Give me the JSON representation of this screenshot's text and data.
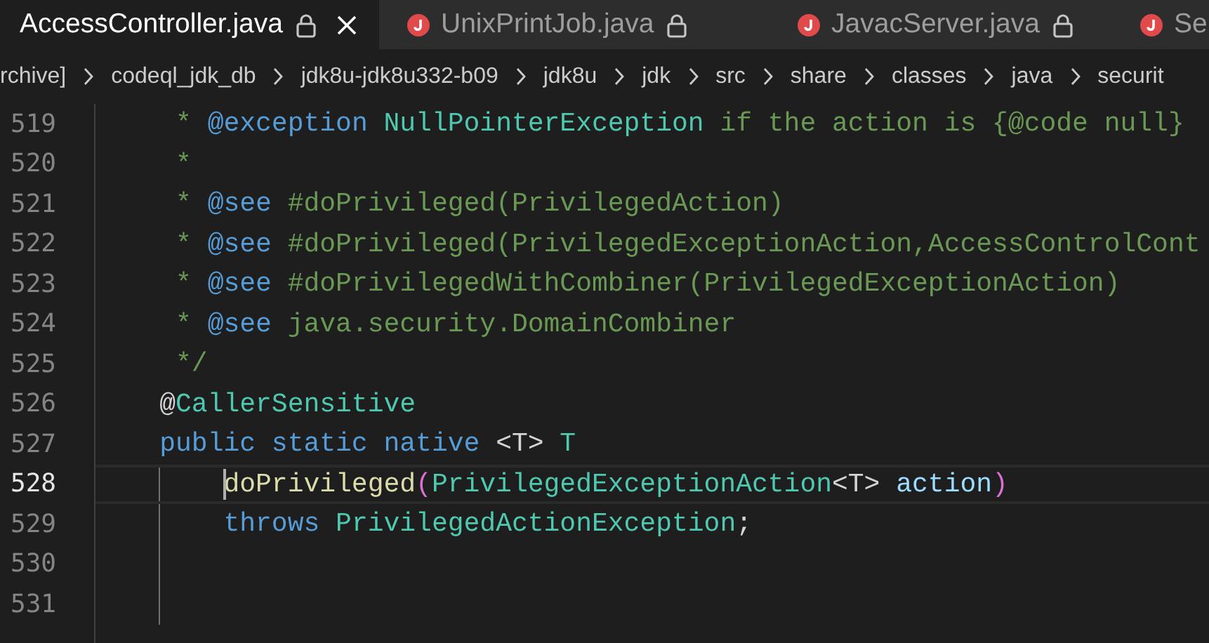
{
  "tabs": [
    {
      "label": "AccessController.java",
      "selected": true,
      "locked": true,
      "closable": true,
      "file_icon": false
    },
    {
      "label": "UnixPrintJob.java",
      "selected": false,
      "locked": true,
      "closable": false,
      "file_icon": true
    },
    {
      "label": "JavacServer.java",
      "selected": false,
      "locked": true,
      "closable": false,
      "file_icon": true
    },
    {
      "label": "Se",
      "selected": false,
      "locked": false,
      "closable": false,
      "file_icon": true
    }
  ],
  "breadcrumbs": [
    "rchive]",
    "codeql_jdk_db",
    "jdk8u-jdk8u332-b09",
    "jdk8u",
    "jdk",
    "src",
    "share",
    "classes",
    "java",
    "securit"
  ],
  "editor": {
    "lines": [
      {
        "number": "519",
        "current": false,
        "in_method": false,
        "tokens": [
          {
            "text": "     * ",
            "kind": "comment"
          },
          {
            "text": "@exception ",
            "kind": "tag"
          },
          {
            "text": "NullPointerException",
            "kind": "type"
          },
          {
            "text": " if the action is {@code null}",
            "kind": "comment"
          }
        ]
      },
      {
        "number": "520",
        "current": false,
        "in_method": false,
        "tokens": [
          {
            "text": "     *",
            "kind": "comment"
          }
        ]
      },
      {
        "number": "521",
        "current": false,
        "in_method": false,
        "tokens": [
          {
            "text": "     * ",
            "kind": "comment"
          },
          {
            "text": "@see",
            "kind": "tag"
          },
          {
            "text": " #doPrivileged(PrivilegedAction)",
            "kind": "comment"
          }
        ]
      },
      {
        "number": "522",
        "current": false,
        "in_method": false,
        "tokens": [
          {
            "text": "     * ",
            "kind": "comment"
          },
          {
            "text": "@see",
            "kind": "tag"
          },
          {
            "text": " #doPrivileged(PrivilegedExceptionAction,AccessControlCont",
            "kind": "comment"
          }
        ]
      },
      {
        "number": "523",
        "current": false,
        "in_method": false,
        "tokens": [
          {
            "text": "     * ",
            "kind": "comment"
          },
          {
            "text": "@see",
            "kind": "tag"
          },
          {
            "text": " #doPrivilegedWithCombiner(PrivilegedExceptionAction)",
            "kind": "comment"
          }
        ]
      },
      {
        "number": "524",
        "current": false,
        "in_method": false,
        "tokens": [
          {
            "text": "     * ",
            "kind": "comment"
          },
          {
            "text": "@see",
            "kind": "tag"
          },
          {
            "text": " java.security.DomainCombiner",
            "kind": "comment"
          }
        ]
      },
      {
        "number": "525",
        "current": false,
        "in_method": false,
        "tokens": [
          {
            "text": "     */",
            "kind": "comment"
          }
        ]
      },
      {
        "number": "526",
        "current": false,
        "in_method": false,
        "tokens": [
          {
            "text": "    @",
            "kind": "plain"
          },
          {
            "text": "CallerSensitive",
            "kind": "type"
          }
        ]
      },
      {
        "number": "527",
        "current": false,
        "in_method": false,
        "tokens": [
          {
            "text": "    public static native",
            "kind": "keyword"
          },
          {
            "text": " <T> ",
            "kind": "plain"
          },
          {
            "text": "T",
            "kind": "type"
          }
        ]
      },
      {
        "number": "528",
        "current": true,
        "in_method": true,
        "tokens": [
          {
            "text": "        doPrivileged",
            "kind": "function",
            "cursor": true
          },
          {
            "text": "(",
            "kind": "bracket"
          },
          {
            "text": "PrivilegedExceptionAction",
            "kind": "type"
          },
          {
            "text": "<T> ",
            "kind": "plain"
          },
          {
            "text": "action",
            "kind": "param"
          },
          {
            "text": ")",
            "kind": "bracket"
          }
        ]
      },
      {
        "number": "529",
        "current": false,
        "in_method": true,
        "tokens": [
          {
            "text": "        throws ",
            "kind": "keyword"
          },
          {
            "text": "PrivilegedActionException",
            "kind": "type"
          },
          {
            "text": ";",
            "kind": "plain"
          }
        ]
      },
      {
        "number": "530",
        "current": false,
        "in_method": true
      },
      {
        "number": "531",
        "current": false,
        "in_method": true
      }
    ]
  }
}
